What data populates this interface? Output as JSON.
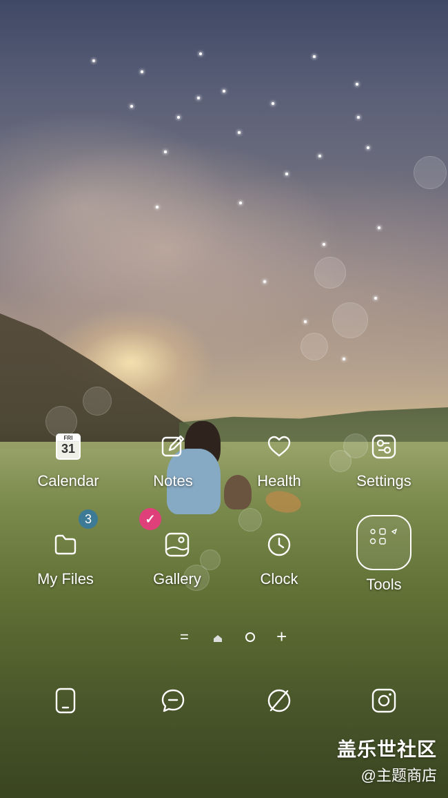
{
  "apps_row1": [
    {
      "label": "Calendar",
      "icon": "calendar-icon",
      "cal_day": "FRI",
      "cal_num": "31"
    },
    {
      "label": "Notes",
      "icon": "notes-icon"
    },
    {
      "label": "Health",
      "icon": "heart-icon"
    },
    {
      "label": "Settings",
      "icon": "settings-icon"
    }
  ],
  "apps_row2": [
    {
      "label": "My Files",
      "icon": "folder-icon",
      "badge": "3"
    },
    {
      "label": "Gallery",
      "icon": "gallery-icon",
      "badge": "✓"
    },
    {
      "label": "Clock",
      "icon": "clock-icon"
    },
    {
      "label": "Tools",
      "icon": "tools-folder-icon"
    }
  ],
  "page_indicator": {
    "menu_glyph": "=",
    "add_glyph": "+"
  },
  "dock": [
    {
      "icon": "phone-icon"
    },
    {
      "icon": "messages-icon"
    },
    {
      "icon": "browser-icon"
    },
    {
      "icon": "camera-icon"
    }
  ],
  "watermark": {
    "line1": "盖乐世社区",
    "line2": "@主题商店"
  },
  "colors": {
    "badge_files": "#3d7a96",
    "badge_gallery": "#e0407a",
    "label": "#ffffff"
  }
}
